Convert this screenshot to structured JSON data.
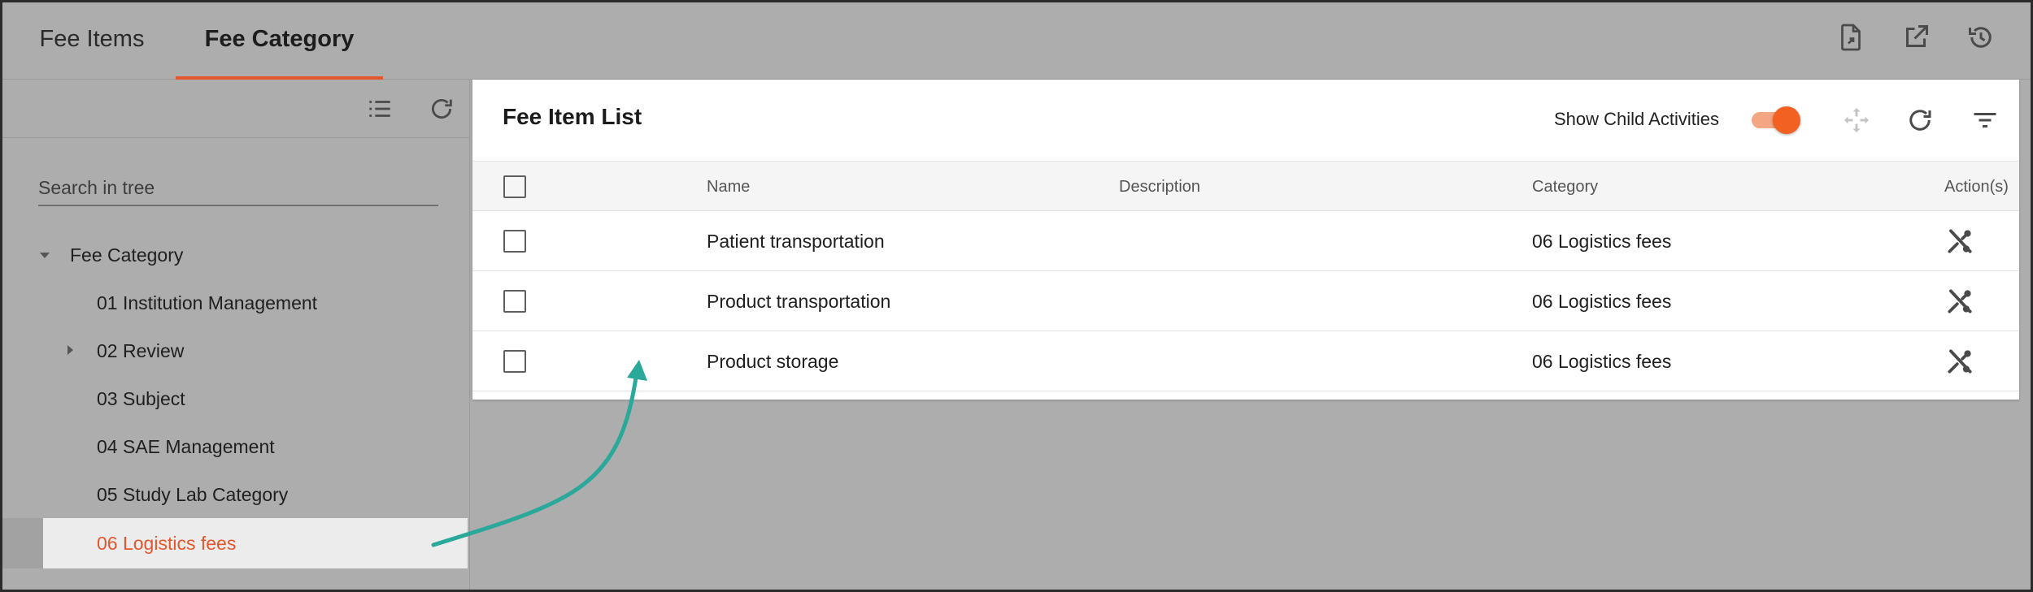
{
  "tabs": [
    {
      "label": "Fee Items",
      "active": false
    },
    {
      "label": "Fee Category",
      "active": true
    }
  ],
  "top_icons": [
    "export-document-icon",
    "open-external-icon",
    "history-icon"
  ],
  "left_pane": {
    "search_placeholder": "Search in tree",
    "tree": [
      {
        "label": "Fee Category",
        "level": 0,
        "expanded": true
      },
      {
        "label": "01 Institution Management",
        "level": 1
      },
      {
        "label": "02 Review",
        "level": 1,
        "collapsed_children": true
      },
      {
        "label": "03 Subject",
        "level": 1
      },
      {
        "label": "04 SAE Management",
        "level": 1
      },
      {
        "label": "05 Study Lab Category",
        "level": 1
      },
      {
        "label": "06 Logistics fees",
        "level": 1,
        "selected": true
      }
    ]
  },
  "panel": {
    "title": "Fee Item List",
    "show_child_label": "Show Child Activities",
    "show_child_on": true,
    "columns": {
      "name": "Name",
      "description": "Description",
      "category": "Category",
      "actions": "Action(s)"
    },
    "rows": [
      {
        "name": "Patient transportation",
        "description": "",
        "category": "06 Logistics fees"
      },
      {
        "name": "Product transportation",
        "description": "",
        "category": "06 Logistics fees"
      },
      {
        "name": "Product storage",
        "description": "",
        "category": "06 Logistics fees"
      }
    ]
  },
  "colors": {
    "accent": "#e4572e",
    "toggle_knob": "#f26122",
    "toggle_track": "#f4a582",
    "annotation_arrow": "#2aa89a",
    "overlay_gray": "#adadad"
  }
}
